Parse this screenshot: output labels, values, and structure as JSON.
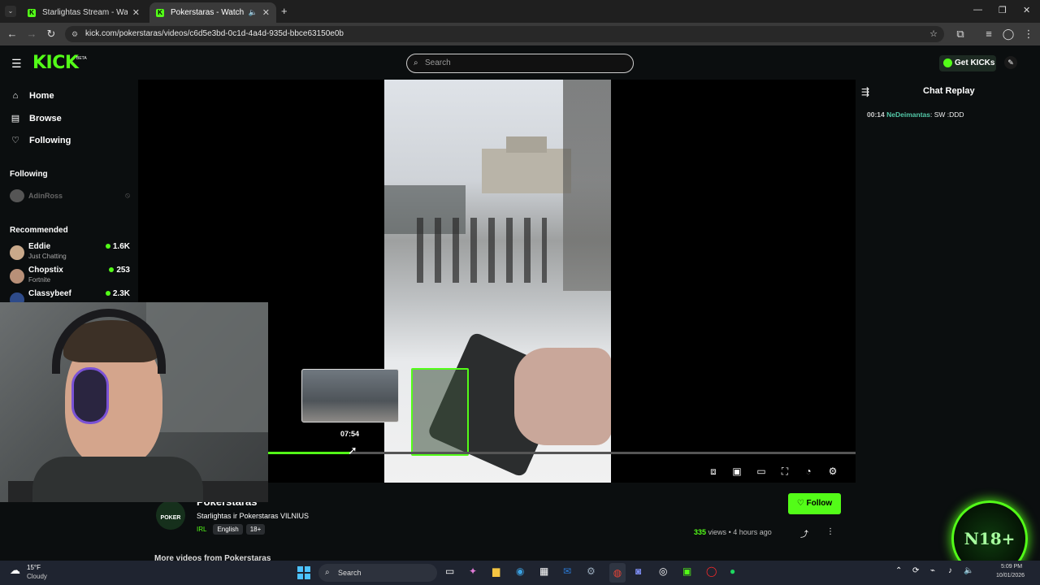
{
  "browser": {
    "tabs": [
      {
        "title": "Starlightas Stream - Watch Live",
        "active": false
      },
      {
        "title": "Pokerstaras - Watch the VO",
        "active": true
      }
    ],
    "url": "kick.com/pokerstaras/videos/c6d5e3bd-0c1d-4a4d-935d-bbce63150e0b"
  },
  "header": {
    "logo": "KICK",
    "beta": "BETA",
    "search_placeholder": "Search",
    "get_kicks": "Get KICKs"
  },
  "sidebar": {
    "nav": [
      {
        "label": "Home",
        "icon": "home-icon"
      },
      {
        "label": "Browse",
        "icon": "browse-icon"
      },
      {
        "label": "Following",
        "icon": "heart-icon"
      }
    ],
    "following_heading": "Following",
    "following": [
      {
        "name": "AdinRoss"
      }
    ],
    "recommended_heading": "Recommended",
    "recommended": [
      {
        "name": "Eddie",
        "category": "Just Chatting",
        "viewers": "1.6K"
      },
      {
        "name": "Chopstix",
        "category": "Fortnite",
        "viewers": "253"
      },
      {
        "name": "Classybeef",
        "category": "",
        "viewers": "2.3K"
      }
    ]
  },
  "player": {
    "hover_time": "07:54",
    "progress_fraction": 0.14,
    "accent": "#53fc18"
  },
  "chat": {
    "title": "Chat Replay",
    "messages": [
      {
        "time": "00:14",
        "user": "NeDeimantas",
        "text": ": SW :DDD"
      }
    ]
  },
  "video_info": {
    "channel": "Pokerstaras",
    "title": "Starlightas ir Pokerstaras VILNIUS",
    "category": "IRL",
    "tags": [
      "English",
      "18+"
    ],
    "views": "335",
    "views_label": "views",
    "age": "4 hours ago",
    "follow": "Follow",
    "more_videos": "More videos from Pokerstaras",
    "avatar_text": "POKER"
  },
  "overlay_badge": "N18+",
  "taskbar": {
    "weather_temp": "15°F",
    "weather_desc": "Cloudy",
    "search": "Search",
    "time": "5:09 PM",
    "date": "10/01/2026"
  }
}
